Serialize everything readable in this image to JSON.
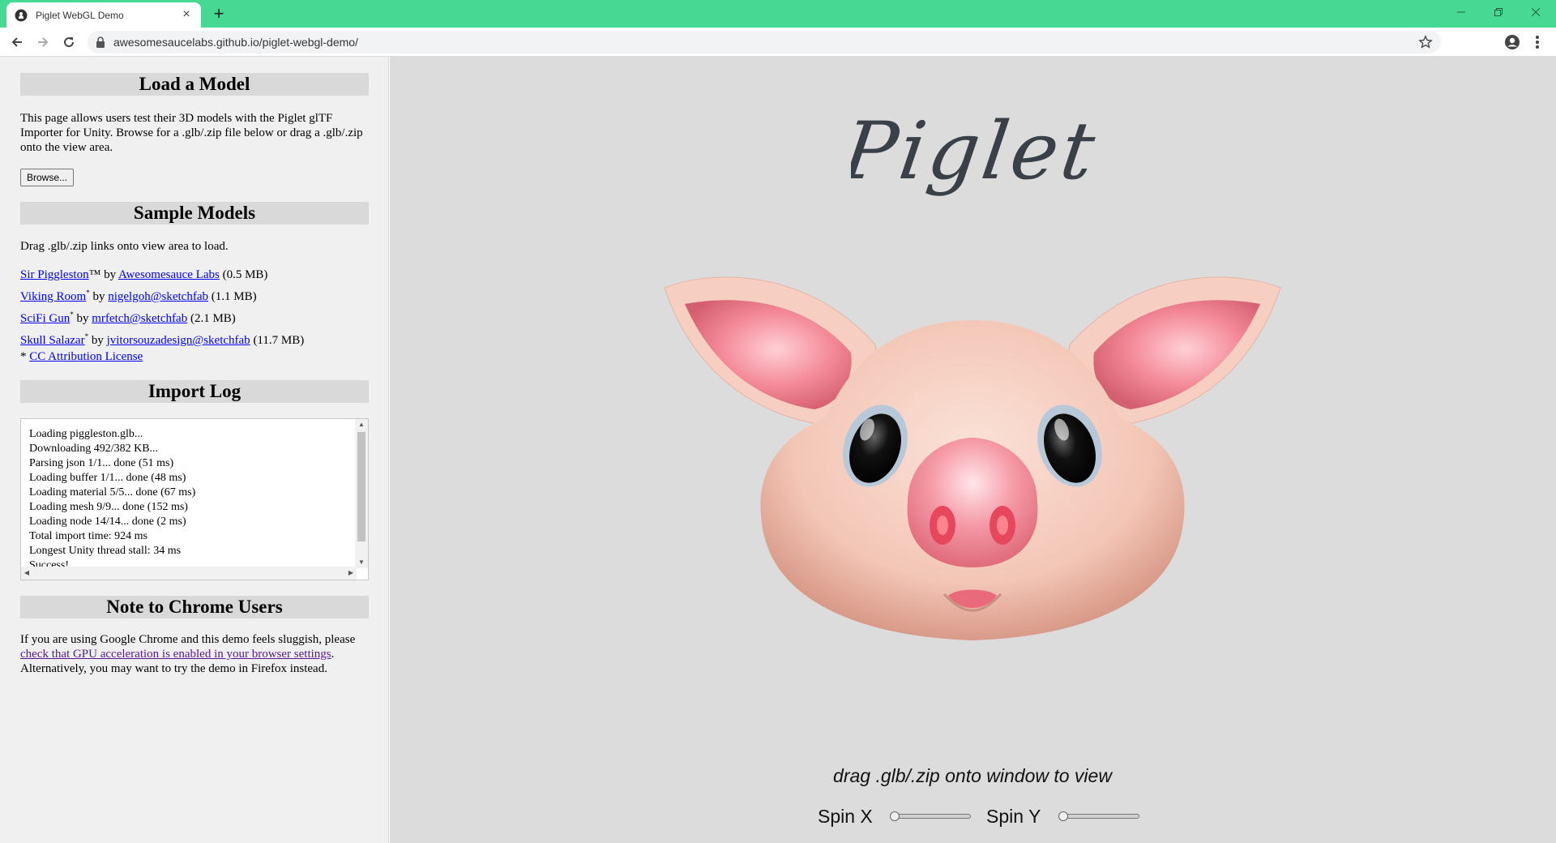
{
  "browser": {
    "tab_title": "Piglet WebGL Demo",
    "url": "awesomesaucelabs.github.io/piglet-webgl-demo/",
    "theme_color": "#46d993"
  },
  "sidebar": {
    "load_model": {
      "heading": "Load a Model",
      "description": "This page allows users test their 3D models with the Piglet glTF Importer for Unity. Browse for a .glb/.zip file below or drag a .glb/.zip onto the view area.",
      "browse_label": "Browse..."
    },
    "sample_models": {
      "heading": "Sample Models",
      "instructions": "Drag .glb/.zip links onto view area to load.",
      "items": [
        {
          "name": "Sir Piggleston",
          "mark": "™",
          "by": " by ",
          "author": "Awesomesauce Labs",
          "size": " (0.5 MB)"
        },
        {
          "name": "Viking Room",
          "mark": "*",
          "by": " by ",
          "author": "nigelgoh@sketchfab",
          "size": " (1.1 MB)"
        },
        {
          "name": "SciFi Gun",
          "mark": "*",
          "by": " by ",
          "author": "mrfetch@sketchfab",
          "size": " (2.1 MB)"
        },
        {
          "name": "Skull Salazar",
          "mark": "*",
          "by": " by ",
          "author": "jvitorsouzadesign@sketchfab",
          "size": " (11.7 MB)"
        }
      ],
      "license_prefix": "* ",
      "license_link": "CC Attribution License"
    },
    "import_log": {
      "heading": "Import Log",
      "lines": [
        "Loading piggleston.glb...",
        "Downloading 492/382 KB...",
        "Parsing json 1/1... done (51 ms)",
        "Loading buffer 1/1... done (48 ms)",
        "Loading material 5/5... done (67 ms)",
        "Loading mesh 9/9... done (152 ms)",
        "Loading node 14/14... done (2 ms)",
        "Total import time: 924 ms",
        "Longest Unity thread stall: 34 ms",
        "Success!"
      ]
    },
    "chrome_note": {
      "heading": "Note to Chrome Users",
      "text_before": "If you are using Google Chrome and this demo feels sluggish, please ",
      "link": "check that GPU acceleration is enabled in your browser settings",
      "text_after": ". Alternatively, you may want to try the demo in Firefox instead."
    }
  },
  "viewer": {
    "logo_text": "Piglet",
    "hint": "drag .glb/.zip onto window to view",
    "spin_x_label": "Spin X",
    "spin_y_label": "Spin Y",
    "spin_x_value": 0,
    "spin_y_value": 0
  }
}
